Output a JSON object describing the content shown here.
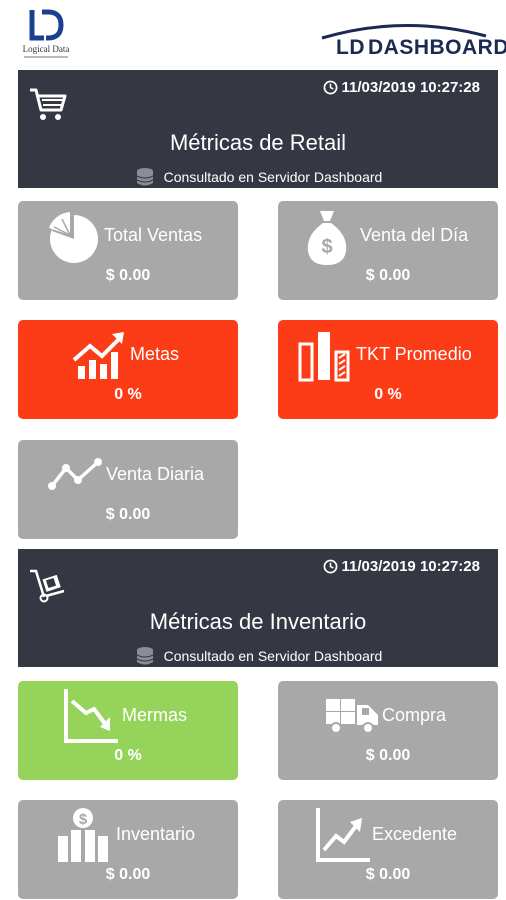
{
  "header": {
    "left_logo_text": "Logical Data",
    "brand_prefix": "LD",
    "brand_name": "DASHBOARD"
  },
  "retail": {
    "timestamp": "11/03/2019 10:27:28",
    "title": "Métricas de Retail",
    "source": "Consultado en Servidor Dashboard",
    "icon": "shopping-cart-icon",
    "cards": {
      "total_ventas": {
        "label": "Total Ventas",
        "value": "$ 0.00",
        "icon": "pie-chart-icon",
        "color": "#a8a8a8"
      },
      "venta_dia": {
        "label": "Venta del Día",
        "value": "$ 0.00",
        "icon": "money-bag-icon",
        "color": "#a8a8a8"
      },
      "metas": {
        "label": "Metas",
        "value": "0 %",
        "icon": "growth-chart-icon",
        "color": "#fc3c16"
      },
      "tkt_promedio": {
        "label": "TKT Promedio",
        "value": "0 %",
        "icon": "bar-columns-icon",
        "color": "#fc3c16"
      },
      "venta_diaria": {
        "label": "Venta Diaria",
        "value": "$ 0.00",
        "icon": "line-trend-icon",
        "color": "#a8a8a8"
      }
    }
  },
  "inventario": {
    "timestamp": "11/03/2019 10:27:28",
    "title": "Métricas de Inventario",
    "source": "Consultado en Servidor Dashboard",
    "icon": "hand-truck-icon",
    "cards": {
      "mermas": {
        "label": "Mermas",
        "value": "0 %",
        "icon": "downtrend-chart-icon",
        "color": "#96d35a"
      },
      "compra": {
        "label": "Compra",
        "value": "$ 0.00",
        "icon": "delivery-truck-icon",
        "color": "#a8a8a8"
      },
      "inventario": {
        "label": "Inventario",
        "value": "$ 0.00",
        "icon": "coin-stacks-icon",
        "color": "#a8a8a8"
      },
      "excedente": {
        "label": "Excedente",
        "value": "$ 0.00",
        "icon": "uptrend-chart-icon",
        "color": "#a8a8a8"
      }
    }
  }
}
